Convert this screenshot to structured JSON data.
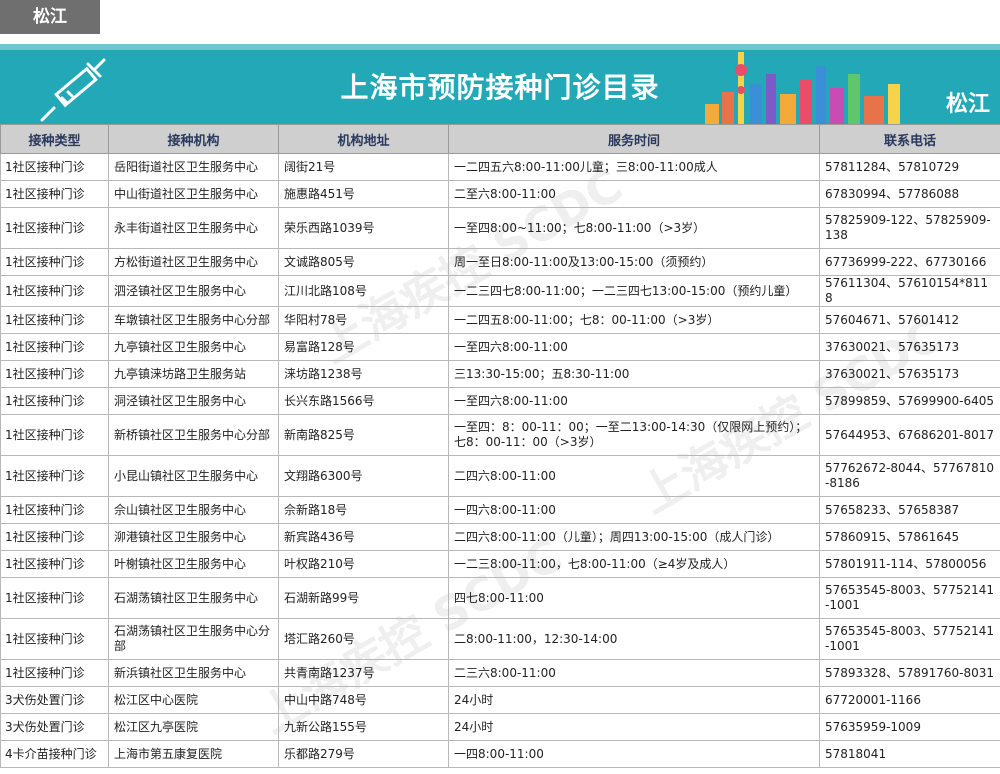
{
  "tag": "松江",
  "banner": {
    "title": "上海市预防接种门诊目录",
    "district": "松江"
  },
  "table": {
    "headers": [
      "接种类型",
      "接种机构",
      "机构地址",
      "服务时间",
      "联系电话"
    ],
    "rows": [
      [
        "1社区接种门诊",
        "岳阳街道社区卫生服务中心",
        "阔街21号",
        "一二四五六8:00-11:00儿童；三8:00-11:00成人",
        "57811284、57810729"
      ],
      [
        "1社区接种门诊",
        "中山街道社区卫生服务中心",
        "施惠路451号",
        "二至六8:00-11:00",
        "67830994、57786088"
      ],
      [
        "1社区接种门诊",
        "永丰街道社区卫生服务中心",
        "荣乐西路1039号",
        "一至四8:00~11:00；七8:00-11:00（>3岁）",
        "57825909-122、57825909-138"
      ],
      [
        "1社区接种门诊",
        "方松街道社区卫生服务中心",
        "文诚路805号",
        "周一至日8:00-11:00及13:00-15:00（须预约）",
        "67736999-222、67730166"
      ],
      [
        "1社区接种门诊",
        "泗泾镇社区卫生服务中心",
        "江川北路108号",
        "一二三四七8:00-11:00；一二三四七13:00-15:00（预约儿童）",
        "57611304、57610154*8118"
      ],
      [
        "1社区接种门诊",
        "车墩镇社区卫生服务中心分部",
        "华阳村78号",
        "一二四五8:00-11:00；七8：00-11:00（>3岁）",
        "57604671、57601412"
      ],
      [
        "1社区接种门诊",
        "九亭镇社区卫生服务中心",
        "易富路128号",
        "一至四六8:00-11:00",
        "37630021、57635173"
      ],
      [
        "1社区接种门诊",
        "九亭镇涞坊路卫生服务站",
        "涞坊路1238号",
        "三13:30-15:00；五8:30-11:00",
        "37630021、57635173"
      ],
      [
        "1社区接种门诊",
        "洞泾镇社区卫生服务中心",
        "长兴东路1566号",
        "一至四六8:00-11:00",
        "57899859、57699900-6405"
      ],
      [
        "1社区接种门诊",
        "新桥镇社区卫生服务中心分部",
        "新南路825号",
        "一至四：8：00-11：00；一至二13:00-14:30（仅限网上预约）；七8：00-11：00（>3岁）",
        "57644953、67686201-8017"
      ],
      [
        "1社区接种门诊",
        "小昆山镇社区卫生服务中心",
        "文翔路6300号",
        "二四六8:00-11:00",
        "57762672-8044、57767810-8186"
      ],
      [
        "1社区接种门诊",
        "佘山镇社区卫生服务中心",
        "佘新路18号",
        "一四六8:00-11:00",
        "57658233、57658387"
      ],
      [
        "1社区接种门诊",
        "泖港镇社区卫生服务中心",
        "新宾路436号",
        "二四六8:00-11:00（儿童）；周四13:00-15:00（成人门诊）",
        "57860915、57861645"
      ],
      [
        "1社区接种门诊",
        "叶榭镇社区卫生服务中心",
        "叶权路210号",
        "一二三8:00-11:00，七8:00-11:00（≥4岁及成人）",
        "57801911-114、57800056"
      ],
      [
        "1社区接种门诊",
        "石湖荡镇社区卫生服务中心",
        "石湖新路99号",
        "四七8:00-11:00",
        "57653545-8003、57752141-1001"
      ],
      [
        "1社区接种门诊",
        "石湖荡镇社区卫生服务中心分部",
        "塔汇路260号",
        "二8:00-11:00，12:30-14:00",
        "57653545-8003、57752141-1001"
      ],
      [
        "1社区接种门诊",
        "新浜镇社区卫生服务中心",
        "共青南路1237号",
        "二三六8:00-11:00",
        "57893328、57891760-8031"
      ],
      [
        "3犬伤处置门诊",
        "松江区中心医院",
        "中山中路748号",
        "24小时",
        "67720001-1166"
      ],
      [
        "3犬伤处置门诊",
        "松江区九亭医院",
        "九新公路155号",
        "24小时",
        "57635959-1009"
      ],
      [
        "4卡介苗接种门诊",
        "上海市第五康复医院",
        "乐都路279号",
        "一四8:00-11:00",
        "57818041"
      ]
    ]
  },
  "colors": {
    "banner": "#22a8b6",
    "header_bg": "#cfcfcf",
    "tag_bg": "#6f6f6f"
  }
}
